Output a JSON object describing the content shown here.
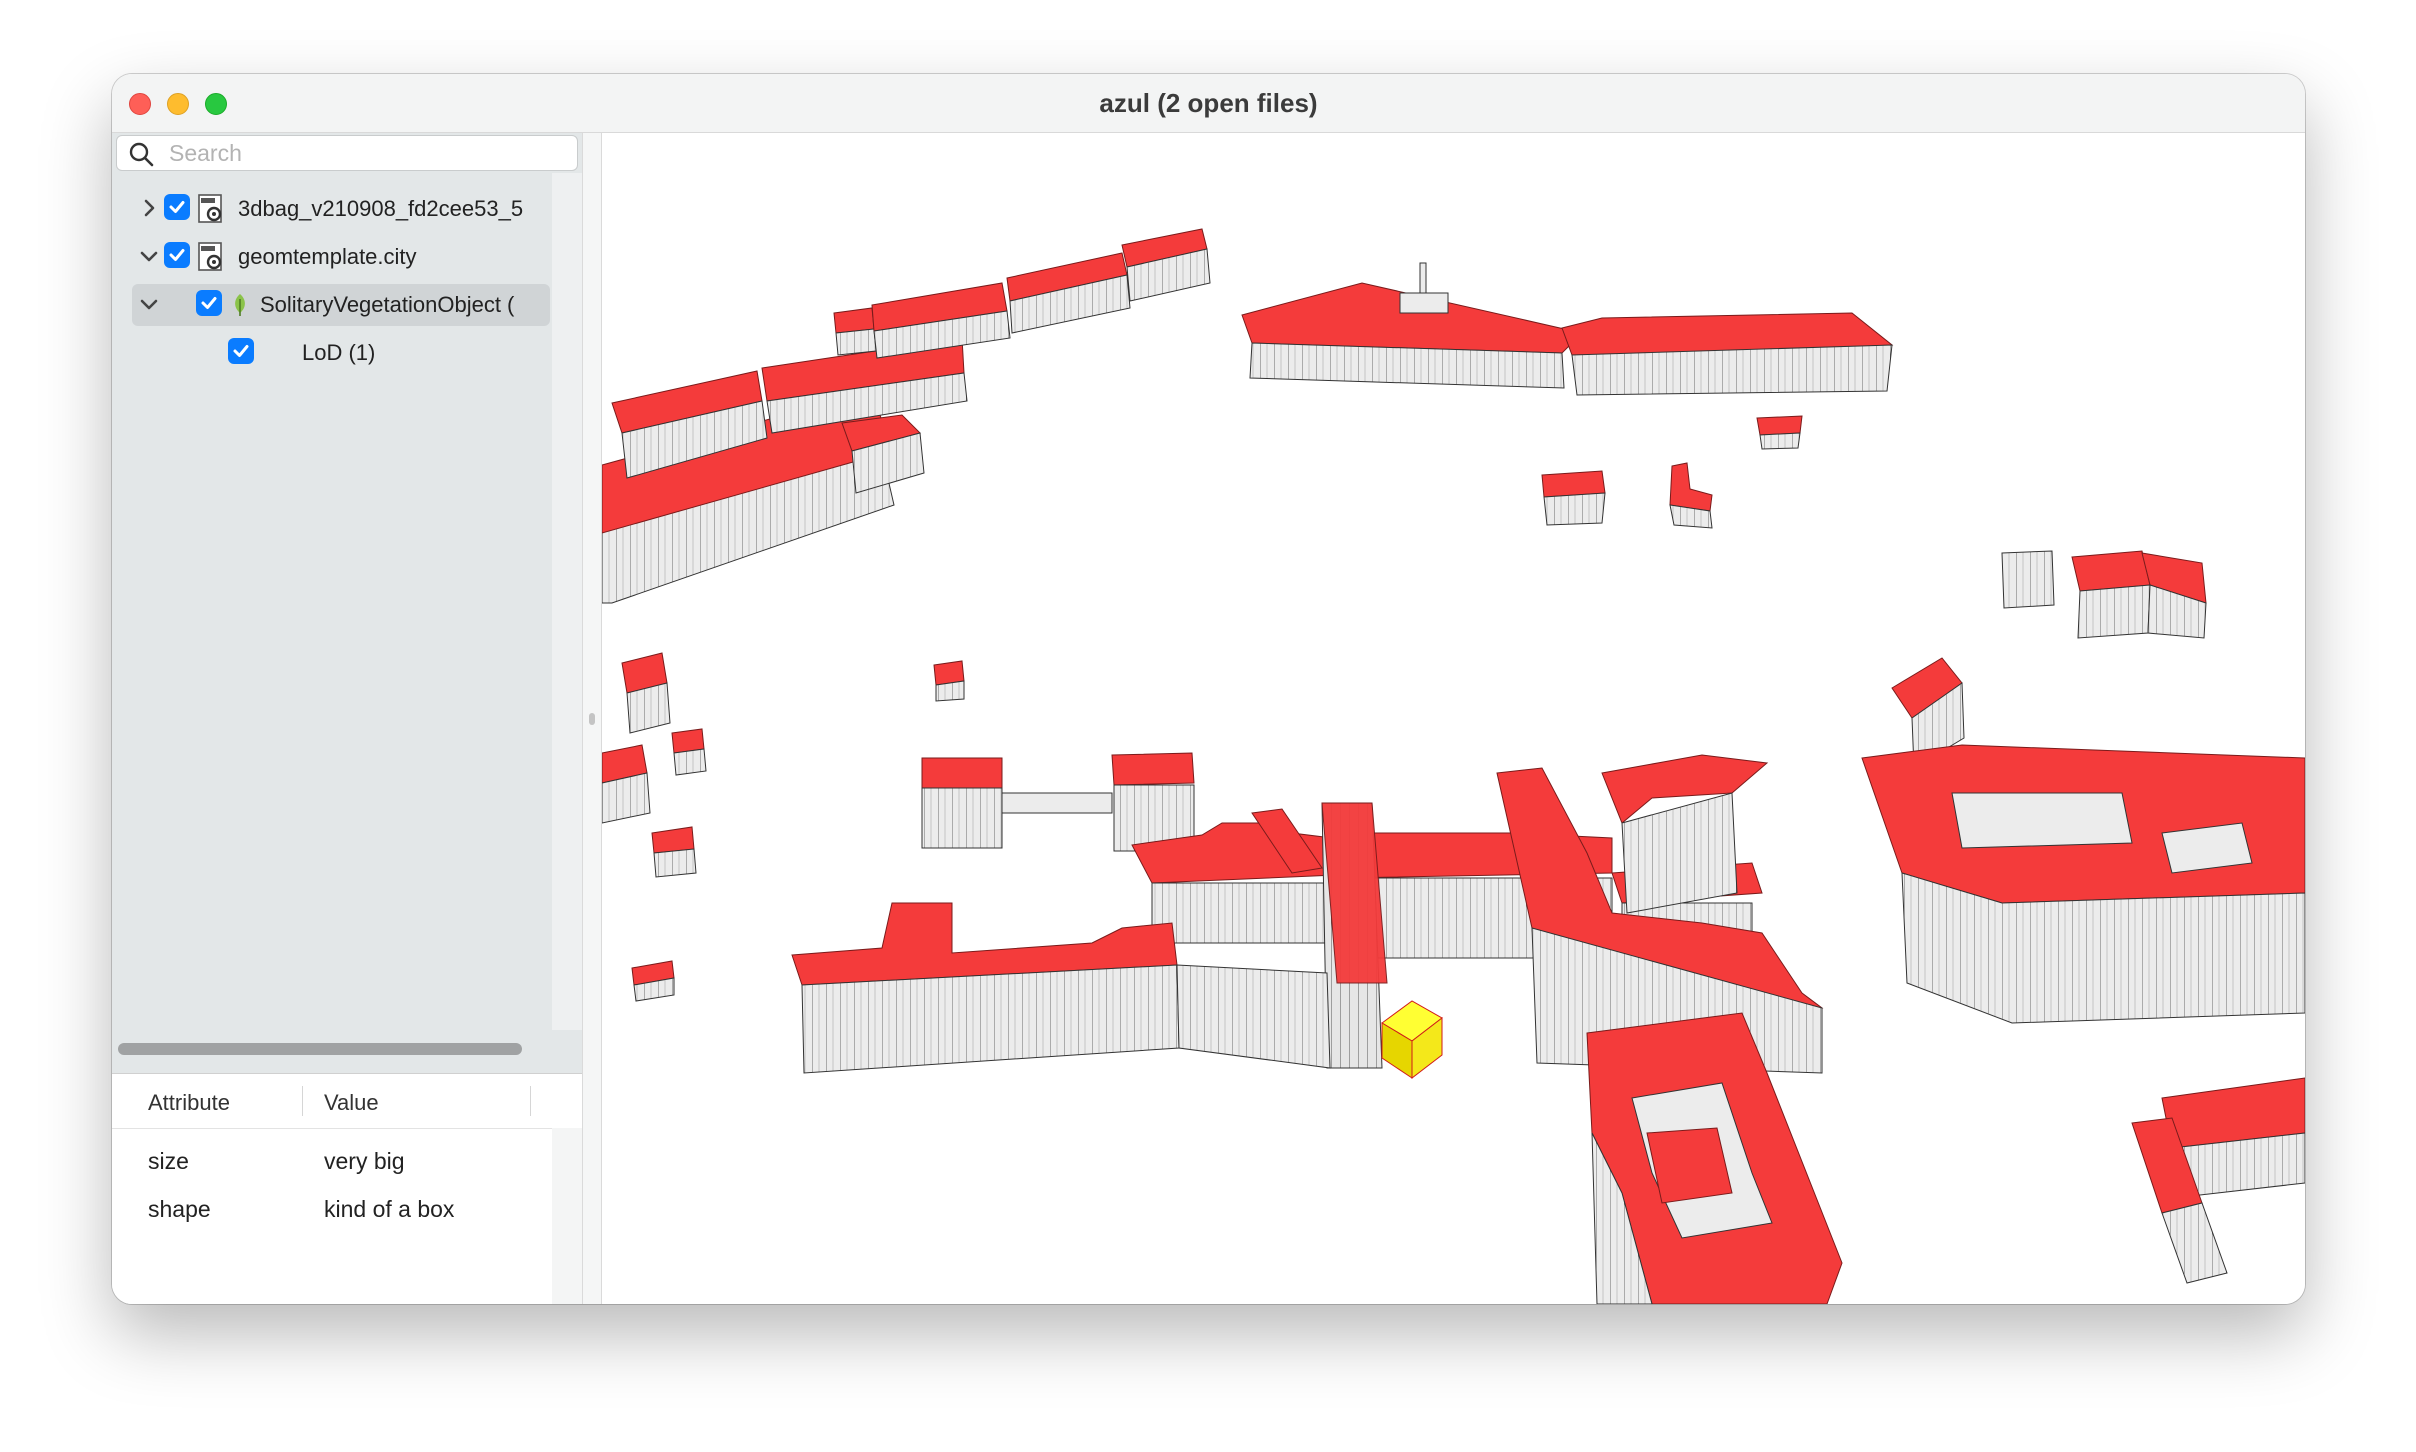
{
  "window": {
    "title": "azul (2 open files)"
  },
  "search": {
    "placeholder": "Search",
    "icon": "magnifier-icon"
  },
  "tree": {
    "items": [
      {
        "label": "3dbag_v210908_fd2cee53_5",
        "expanded": false,
        "checked": true,
        "icon": "cityjson-file-icon"
      },
      {
        "label": "geomtemplate.city",
        "expanded": true,
        "checked": true,
        "icon": "cityjson-file-icon"
      },
      {
        "label": "SolitaryVegetationObject (",
        "expanded": true,
        "checked": true,
        "icon": "vegetation-leaf-icon",
        "selected": true
      },
      {
        "label": "LoD (1)",
        "checked": true
      }
    ]
  },
  "attributes": {
    "headers": {
      "attribute": "Attribute",
      "value": "Value"
    },
    "rows": [
      {
        "attribute": "size",
        "value": "very big"
      },
      {
        "attribute": "shape",
        "value": "kind of a box"
      }
    ]
  },
  "viewport": {
    "description": "3D city model view",
    "roof_color": "#f43b3b",
    "wall_color": "#ececec",
    "selection_color": "#ffff1a"
  }
}
